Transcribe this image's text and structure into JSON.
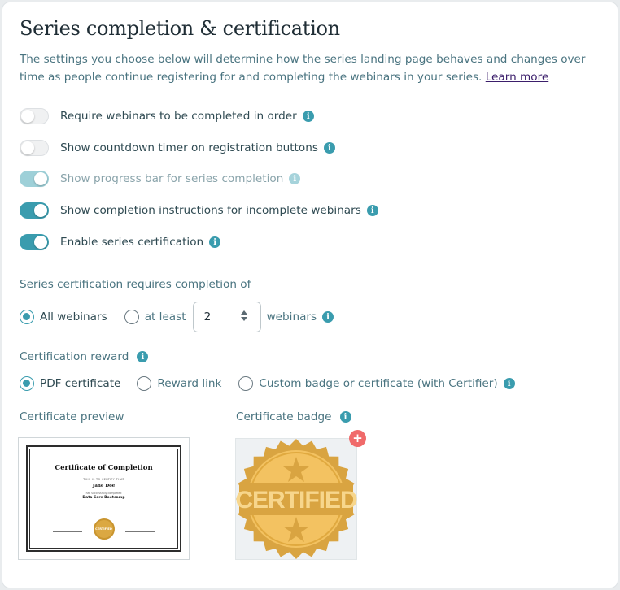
{
  "header": {
    "title": "Series completion & certification",
    "description": "The settings you choose below will determine how the series landing page behaves and changes over time as people continue registering for and completing the webinars in your series.",
    "learn_more": "Learn more"
  },
  "toggles": [
    {
      "label": "Require webinars to be completed in order",
      "state": "off",
      "disabled": false
    },
    {
      "label": "Show countdown timer on registration buttons",
      "state": "off",
      "disabled": false
    },
    {
      "label": "Show progress bar for series completion",
      "state": "on",
      "disabled": true
    },
    {
      "label": "Show completion instructions for incomplete webinars",
      "state": "on",
      "disabled": false
    },
    {
      "label": "Enable series certification",
      "state": "on",
      "disabled": false
    }
  ],
  "requirement": {
    "label": "Series certification requires completion of",
    "all_label": "All webinars",
    "at_least_label": "at least",
    "count_value": "2",
    "unit_label": "webinars",
    "selected": "all"
  },
  "reward": {
    "label": "Certification reward",
    "options": [
      "PDF certificate",
      "Reward link",
      "Custom badge or certificate (with Certifier)"
    ],
    "selected": "PDF certificate"
  },
  "preview": {
    "preview_label": "Certificate preview",
    "badge_label": "Certificate badge",
    "certificate": {
      "title": "Certificate of Completion",
      "subtitle": "THIS IS TO CERTIFY THAT",
      "name": "Jane Doe",
      "note": "has successfully completed",
      "course": "Data Core Bootcamp",
      "seal": "CERTIFIED"
    },
    "badge_text": "CERTIFIED",
    "add_symbol": "+"
  },
  "colors": {
    "accent": "#3a9cae",
    "badge_gold": "#d9a441",
    "add_button": "#f06a6a"
  },
  "icons": {
    "info": "info-icon",
    "add": "plus-icon"
  }
}
